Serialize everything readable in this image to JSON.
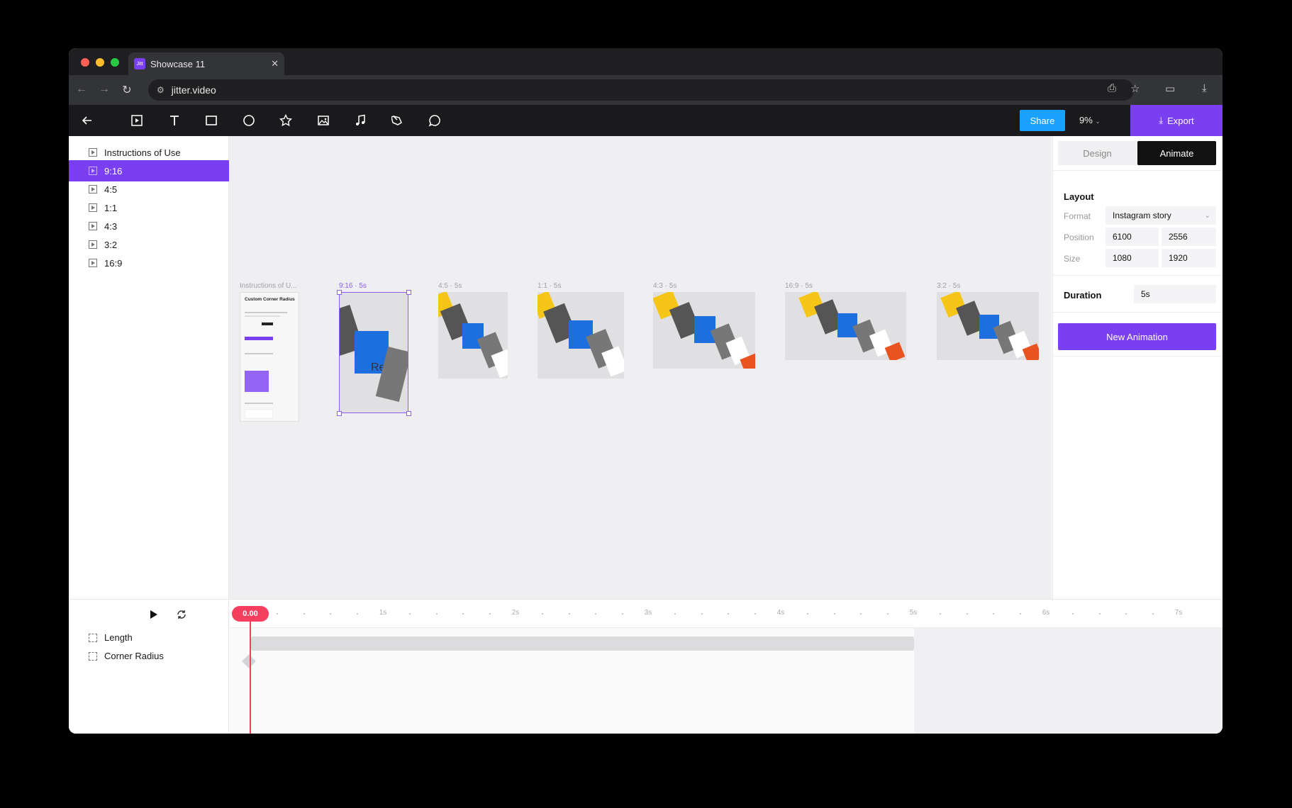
{
  "browser": {
    "tab_title": "Showcase 11",
    "tab_favicon": "Jitt",
    "url": "jitter.video",
    "traffic_lights": [
      "#ff5f57",
      "#febc2e",
      "#28c840"
    ]
  },
  "toolbar": {
    "tools": [
      "back-arrow-icon",
      "frame-icon",
      "text-icon",
      "rectangle-icon",
      "ellipse-icon",
      "star-icon",
      "image-icon",
      "music-icon",
      "pen-icon",
      "comment-icon"
    ],
    "share_label": "Share",
    "zoom_label": "9%",
    "export_label": "Export",
    "accent": "#7b3ff2",
    "share_color": "#1aa0ff"
  },
  "layers": [
    {
      "label": "Instructions of Use",
      "active": false
    },
    {
      "label": "9:16",
      "active": true
    },
    {
      "label": "4:5",
      "active": false
    },
    {
      "label": "1:1",
      "active": false
    },
    {
      "label": "4:3",
      "active": false
    },
    {
      "label": "3:2",
      "active": false
    },
    {
      "label": "16:9",
      "active": false
    }
  ],
  "canvas": {
    "frames": [
      {
        "label": "Instructions of U...",
        "kind": "instructions",
        "title": "Custom Corner Radius"
      },
      {
        "label": "9:16",
        "duration": "5s",
        "selected": true
      },
      {
        "label": "4:5",
        "duration": "5s"
      },
      {
        "label": "1:1",
        "duration": "5s"
      },
      {
        "label": "4:3",
        "duration": "5s"
      },
      {
        "label": "16:9",
        "duration": "5s"
      },
      {
        "label": "3:2",
        "duration": "5s"
      }
    ]
  },
  "inspector": {
    "tabs": [
      "Design",
      "Animate"
    ],
    "active_tab": "Animate",
    "layout_heading": "Layout",
    "format_label": "Format",
    "format_value": "Instagram story",
    "position_label": "Position",
    "position_x": "6100",
    "position_y": "2556",
    "size_label": "Size",
    "size_w": "1080",
    "size_h": "1920",
    "duration_label": "Duration",
    "duration_value": "5s",
    "new_animation_label": "New Animation"
  },
  "timeline": {
    "current_time": "0.00",
    "ruler_labels": [
      "1s",
      "2s",
      "3s",
      "4s",
      "5s",
      "6s",
      "7s"
    ],
    "tracks": [
      "Length",
      "Corner Radius"
    ]
  }
}
